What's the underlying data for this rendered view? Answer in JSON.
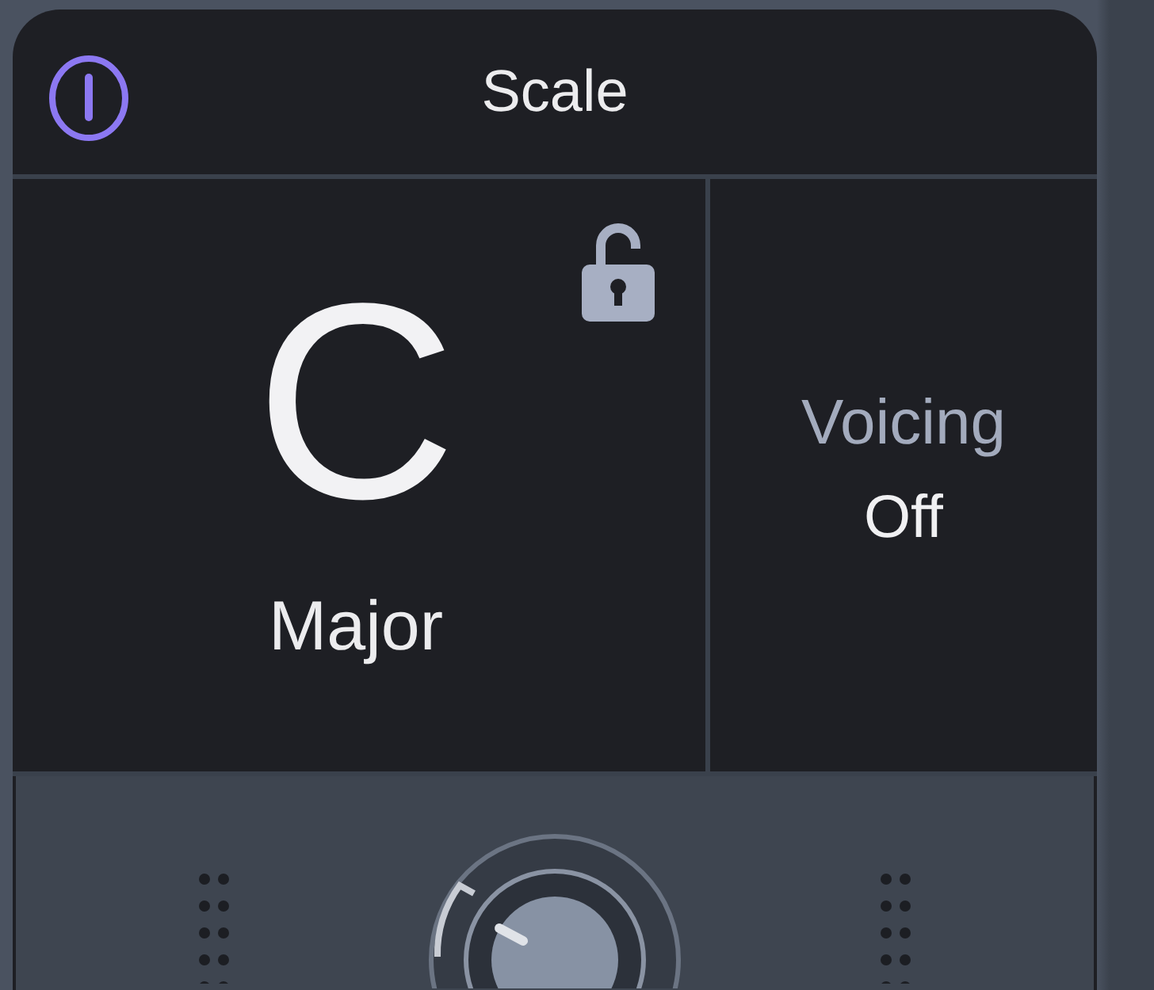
{
  "header": {
    "title": "Scale",
    "power": {
      "on": true
    }
  },
  "key": {
    "note": "C",
    "scale": "Major",
    "locked": false
  },
  "voicing": {
    "label": "Voicing",
    "value": "Off"
  }
}
